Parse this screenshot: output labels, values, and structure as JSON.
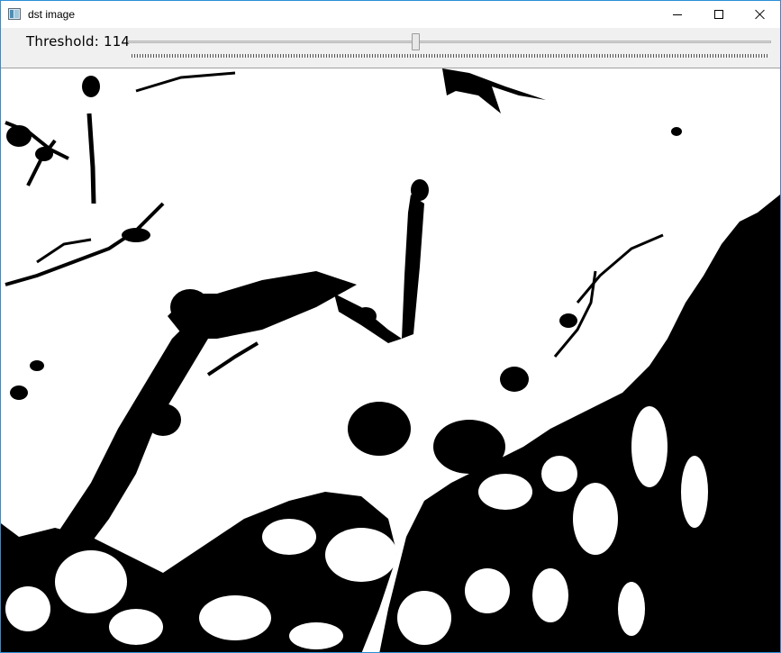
{
  "window": {
    "title": "dst image",
    "icon": "app-window-icon",
    "controls": [
      "minimize-icon",
      "maximize-icon",
      "close-icon"
    ]
  },
  "toolbar": {
    "trackbar_label": "Threshold: 114",
    "trackbar_value": 114,
    "trackbar_max": 255
  },
  "image": {
    "description_kind": "binary-threshold-image",
    "colors": {
      "foreground": "#000000",
      "background": "#ffffff"
    }
  },
  "colors": {
    "frame_border": "#2b8fd6",
    "toolbar_bg": "#f0f0f0"
  }
}
